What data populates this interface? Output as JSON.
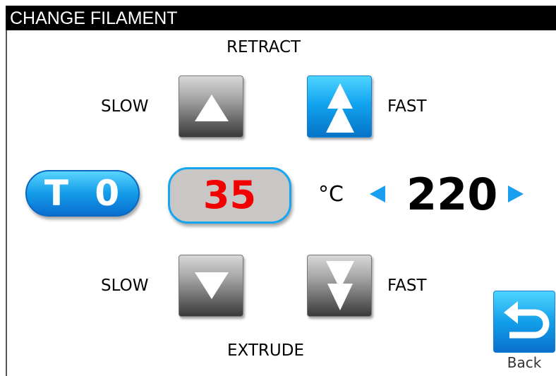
{
  "title": "CHANGE FILAMENT",
  "retract": {
    "heading": "RETRACT",
    "slow_label": "SLOW",
    "fast_label": "FAST"
  },
  "extrude": {
    "heading": "EXTRUDE",
    "slow_label": "SLOW",
    "fast_label": "FAST"
  },
  "tool": {
    "label": "T 0"
  },
  "temperature": {
    "current": "35",
    "unit": "°C",
    "target": "220",
    "decrease_icon": "triangle-left",
    "increase_icon": "triangle-right"
  },
  "back": {
    "label": "Back",
    "icon": "return-arrow"
  },
  "colors": {
    "accent_blue": "#149ce9",
    "current_temp_text": "#f20000",
    "titlebar": "#000000"
  }
}
